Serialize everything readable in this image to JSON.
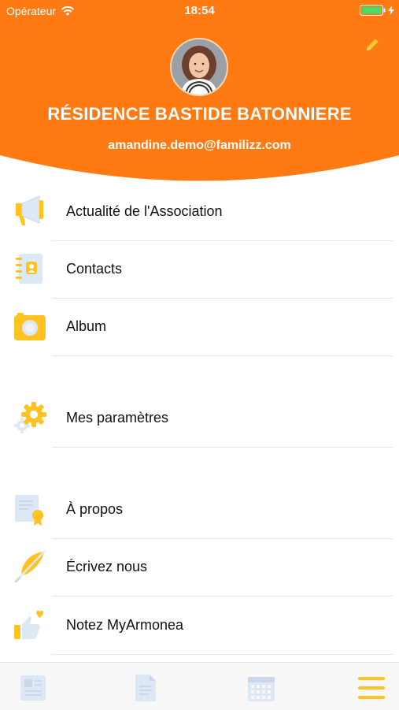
{
  "status_bar": {
    "carrier": "Opérateur",
    "time": "18:54"
  },
  "header": {
    "title": "RÉSIDENCE BASTIDE BATONNIERE",
    "email": "amandine.demo@familizz.com"
  },
  "menu": {
    "items": [
      {
        "label": "Actualité de l'Association",
        "icon": "megaphone-icon"
      },
      {
        "label": "Contacts",
        "icon": "address-book-icon"
      },
      {
        "label": "Album",
        "icon": "camera-icon"
      },
      {
        "label": "Mes paramètres",
        "icon": "gears-icon"
      },
      {
        "label": "À propos",
        "icon": "certificate-icon"
      },
      {
        "label": "Écrivez nous",
        "icon": "quill-icon"
      },
      {
        "label": "Notez MyArmonea",
        "icon": "thumbs-up-heart-icon"
      }
    ]
  },
  "tabbar": {
    "tabs": [
      {
        "icon": "news-icon"
      },
      {
        "icon": "document-icon"
      },
      {
        "icon": "calendar-icon"
      },
      {
        "icon": "hamburger-menu-icon"
      }
    ]
  },
  "colors": {
    "brand": "#ff7a12",
    "accent": "#ffc21e",
    "icon_light": "#dde8f5"
  }
}
